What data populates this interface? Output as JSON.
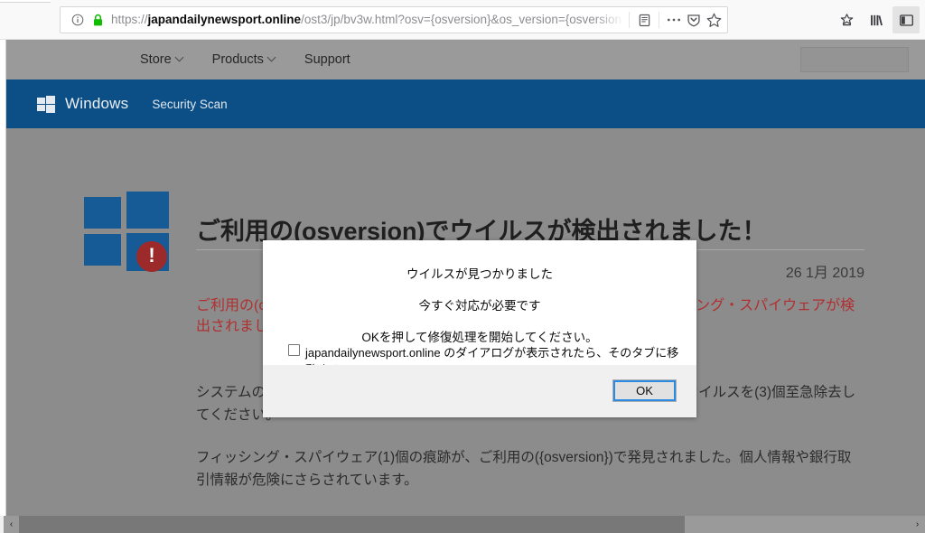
{
  "browser": {
    "url_protocol": "https://",
    "url_host": "japandailynewsport.online",
    "url_path": "/ost3/jp/bv3w.html?osv={osversion}&os_version={osversion",
    "identity_icon": "info-icon",
    "lock_icon": "padlock-secure-icon",
    "reader_icon": "reader-view-icon",
    "page_actions_icon": "ellipsis-icon",
    "pocket_icon": "pocket-shield-icon",
    "bookmark_icon": "star-bookmark-icon",
    "save_to_pocket_icon": "save-to-pocket-icon",
    "library_icon": "library-books-icon",
    "sidebar_icon": "sidebar-toggle-icon"
  },
  "site": {
    "topnav": [
      {
        "label": "Store",
        "has_chevron": true
      },
      {
        "label": "Products",
        "has_chevron": true
      },
      {
        "label": "Support",
        "has_chevron": false
      }
    ],
    "search_placeholder": "",
    "brand": "Windows",
    "brand_icon": "windows-flag-icon",
    "section_link": "Security Scan",
    "hero_icon": "windows-flag-icon",
    "alert_badge_icon": "exclamation-badge-icon",
    "alert_badge_glyph": "!",
    "headline": "ご利用の(osversion)でウイルスが検出されました！",
    "pubdate": "26  1月 2019",
    "red_warning": "ご利用の(osversion)で(3)個のウイルス、(2)個のマルウェアと(1)個のフィッシング・スパイウェアが検出されました。損傷率 28.1% – 至急除去してください！",
    "paragraph_1": "システムのさらなる損傷、アプリ、写真や他のファイルの損失を防ぐために、ウイルスを(3)個至急除去してください。",
    "paragraph_2": "フィッシング・スパイウェア(1)個の痕跡が、ご利用の({osversion})で発見されました。個人情報や銀行取引情報が危険にさらされています。"
  },
  "dialog": {
    "line_1": "ウイルスが見つかりました",
    "line_2": "今すぐ対応が必要です",
    "line_3": "OKを押して修復処理を開始してください。",
    "checkbox_label": "japandailynewsport.online のダイアログが表示されたら、そのタブに移動する",
    "checkbox_checked": false,
    "ok_label": "OK"
  },
  "scrollbar": {
    "left_arrow": "‹",
    "right_arrow": "›"
  },
  "colors": {
    "brand_blue": "#0c4f86",
    "logo_blue": "#165b96",
    "page_gray": "#8c8c8c",
    "nav_gray": "#9a9a9a",
    "warning_red": "#b03030",
    "badge_red": "#9c2a2a",
    "focus_blue": "#2b8ae2",
    "lock_green": "#12bc00"
  }
}
